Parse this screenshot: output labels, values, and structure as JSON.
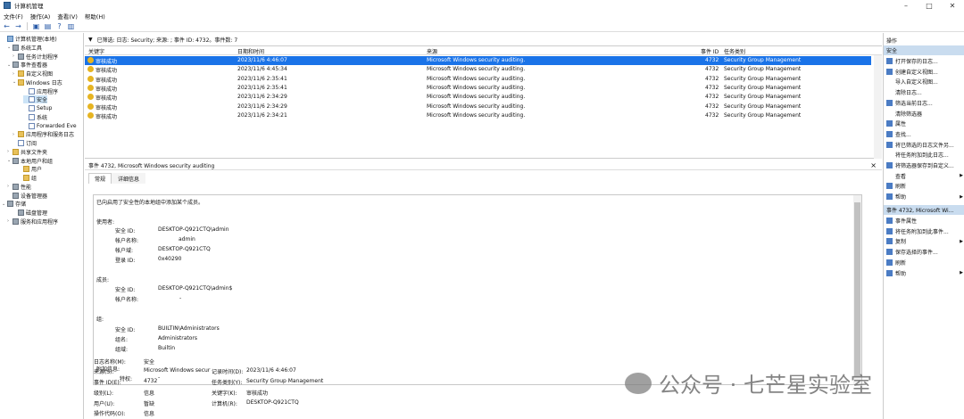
{
  "window": {
    "title": "计算机管理",
    "controls": [
      "–",
      "□",
      "✕"
    ]
  },
  "menu": [
    "文件(F)",
    "操作(A)",
    "查看(V)",
    "帮助(H)"
  ],
  "toolbar": [
    "←",
    "→",
    "▣",
    "▤",
    "?",
    "▥"
  ],
  "tree": [
    {
      "label": "计算机管理(本地)",
      "icon": "computer-icon",
      "twist": ""
    },
    {
      "label": "系统工具",
      "icon": "tools-icon",
      "twist": "⌄"
    },
    {
      "label": "任务计划程序",
      "icon": "clock-icon",
      "twist": "›"
    },
    {
      "label": "事件查看器",
      "icon": "event-viewer-icon",
      "twist": "⌄"
    },
    {
      "label": "自定义视图",
      "icon": "folder-icon",
      "twist": "›"
    },
    {
      "label": "Windows 日志",
      "icon": "folder-icon",
      "twist": "⌄"
    },
    {
      "label": "应用程序",
      "icon": "log-icon",
      "twist": ""
    },
    {
      "label": "安全",
      "icon": "log-icon",
      "twist": ""
    },
    {
      "label": "Setup",
      "icon": "log-icon",
      "twist": ""
    },
    {
      "label": "系统",
      "icon": "log-icon",
      "twist": ""
    },
    {
      "label": "Forwarded Eve",
      "icon": "log-icon",
      "twist": ""
    },
    {
      "label": "应用程序和服务日志",
      "icon": "folder-icon",
      "twist": "›"
    },
    {
      "label": "订阅",
      "icon": "log-icon",
      "twist": ""
    },
    {
      "label": "共享文件夹",
      "icon": "folder-icon",
      "twist": "›"
    },
    {
      "label": "本地用户和组",
      "icon": "users-icon",
      "twist": "⌄"
    },
    {
      "label": "用户",
      "icon": "folder-icon",
      "twist": ""
    },
    {
      "label": "组",
      "icon": "folder-icon",
      "twist": ""
    },
    {
      "label": "性能",
      "icon": "performance-icon",
      "twist": "›"
    },
    {
      "label": "设备管理器",
      "icon": "device-icon",
      "twist": ""
    },
    {
      "label": "存储",
      "icon": "storage-icon",
      "twist": "⌄"
    },
    {
      "label": "磁盘管理",
      "icon": "disk-icon",
      "twist": ""
    },
    {
      "label": "服务和应用程序",
      "icon": "services-icon",
      "twist": "›"
    }
  ],
  "filter": {
    "text": "已筛选: 日志: Security; 来源: ; 事件 ID: 4732。事件数: 7"
  },
  "grid": {
    "headers": [
      "关键字",
      "日期和时间",
      "来源",
      "事件 ID",
      "任务类别"
    ],
    "rows": [
      [
        "审核成功",
        "2023/11/6 4:46:07",
        "Microsoft Windows security auditing.",
        "4732",
        "Security Group Management"
      ],
      [
        "审核成功",
        "2023/11/6 4:45:34",
        "Microsoft Windows security auditing.",
        "4732",
        "Security Group Management"
      ],
      [
        "审核成功",
        "2023/11/6 2:35:41",
        "Microsoft Windows security auditing.",
        "4732",
        "Security Group Management"
      ],
      [
        "审核成功",
        "2023/11/6 2:35:41",
        "Microsoft Windows security auditing.",
        "4732",
        "Security Group Management"
      ],
      [
        "审核成功",
        "2023/11/6 2:34:29",
        "Microsoft Windows security auditing.",
        "4732",
        "Security Group Management"
      ],
      [
        "审核成功",
        "2023/11/6 2:34:29",
        "Microsoft Windows security auditing.",
        "4732",
        "Security Group Management"
      ],
      [
        "审核成功",
        "2023/11/6 2:34:21",
        "Microsoft Windows security auditing.",
        "4732",
        "Security Group Management"
      ]
    ]
  },
  "details": {
    "header": "事件 4732, Microsoft Windows security auditing",
    "tabs": [
      "常规",
      "详细信息"
    ],
    "description": {
      "intro": "已向启用了安全性的本地组中添加某个成员。",
      "subject_title": "使用者:",
      "subject": [
        [
          "安全 ID:",
          "DESKTOP-Q921CTQ\\admin"
        ],
        [
          "帐户名称:",
          "admin"
        ],
        [
          "帐户域:",
          "DESKTOP-Q921CTQ"
        ],
        [
          "登录 ID:",
          "0x40290"
        ]
      ],
      "member_title": "成员:",
      "member": [
        [
          "安全 ID:",
          "DESKTOP-Q921CTQ\\admin$"
        ],
        [
          "帐户名称:",
          "-"
        ]
      ],
      "group_title": "组:",
      "group": [
        [
          "安全 ID:",
          "BUILTIN\\Administrators"
        ],
        [
          "组名:",
          "Administrators"
        ],
        [
          "组域:",
          "Builtin"
        ]
      ],
      "extra_title": "附加信息:",
      "extra": [
        [
          "特权:",
          "-"
        ]
      ]
    },
    "props": {
      "log_name_label": "日志名称(M):",
      "log_name": "安全",
      "source_label": "来源(S):",
      "source": "Microsoft Windows secur",
      "logged_label": "记录时间(D):",
      "logged": "2023/11/6 4:46:07",
      "eventid_label": "事件 ID(E):",
      "eventid": "4732",
      "category_label": "任务类别(Y):",
      "category": "Security Group Management",
      "level_label": "级别(L):",
      "level": "信息",
      "keywords_label": "关键字(K):",
      "keywords": "审核成功",
      "user_label": "用户(U):",
      "user": "暂缺",
      "computer_label": "计算机(R):",
      "computer": "DESKTOP-Q921CTQ",
      "opcode_label": "操作代码(O):",
      "opcode": "信息"
    }
  },
  "actions": {
    "title": "操作",
    "section1": "安全",
    "items1": [
      {
        "label": "打开保存的日志...",
        "icon": "open-log-icon",
        "arrow": false
      },
      {
        "label": "创建自定义视图...",
        "icon": "filter-create-icon",
        "arrow": false
      },
      {
        "label": "导入自定义视图...",
        "icon": "",
        "arrow": false
      },
      {
        "label": "清除日志...",
        "icon": "",
        "arrow": false
      },
      {
        "label": "筛选当前日志...",
        "icon": "filter-icon",
        "arrow": false
      },
      {
        "label": "清除筛选器",
        "icon": "",
        "arrow": false
      },
      {
        "label": "属性",
        "icon": "properties-icon",
        "arrow": false
      },
      {
        "label": "查找...",
        "icon": "find-icon",
        "arrow": false
      },
      {
        "label": "将已筛选的日志文件另...",
        "icon": "save-icon",
        "arrow": false
      },
      {
        "label": "将任务附加到此日志...",
        "icon": "",
        "arrow": false
      },
      {
        "label": "将筛选器保存到自定义...",
        "icon": "save-filter-icon",
        "arrow": false
      },
      {
        "label": "查看",
        "icon": "",
        "arrow": true
      },
      {
        "label": "刷新",
        "icon": "refresh-icon",
        "arrow": false
      },
      {
        "label": "帮助",
        "icon": "help-icon",
        "arrow": true
      }
    ],
    "section2": "事件 4732, Microsoft Wi...",
    "items2": [
      {
        "label": "事件属性",
        "icon": "event-properties-icon",
        "arrow": false
      },
      {
        "label": "将任务附加到此事件...",
        "icon": "attach-task-icon",
        "arrow": false
      },
      {
        "label": "复制",
        "icon": "copy-icon",
        "arrow": true
      },
      {
        "label": "保存选择的事件...",
        "icon": "save-icon",
        "arrow": false
      },
      {
        "label": "刷新",
        "icon": "refresh-icon",
        "arrow": false
      },
      {
        "label": "帮助",
        "icon": "help-icon",
        "arrow": true
      }
    ]
  },
  "watermark": "公众号 · 七芒星实验室"
}
